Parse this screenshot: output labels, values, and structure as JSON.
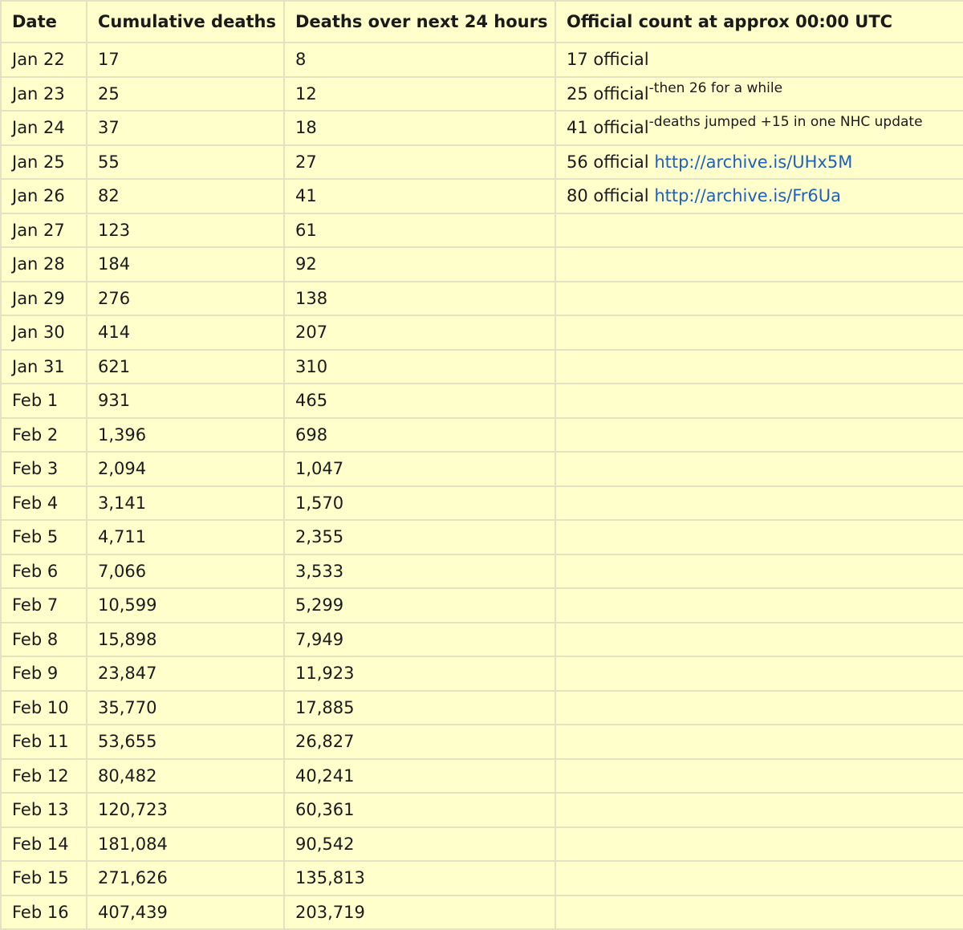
{
  "colors": {
    "background": "#ffffcc",
    "border": "#e3e3c4",
    "text": "#1a1a1a",
    "link": "#1f5fbf"
  },
  "headers": {
    "date": "Date",
    "cumulative": "Cumulative deaths",
    "next24": "Deaths over next 24 hours",
    "official": "Official count at approx 00:00 UTC"
  },
  "rows": [
    {
      "date": "Jan 22",
      "cumulative": "17",
      "next24": "8",
      "official": "17 official",
      "note": "",
      "link": ""
    },
    {
      "date": "Jan 23",
      "cumulative": "25",
      "next24": "12",
      "official": "25 official",
      "note": "-then 26 for a while",
      "link": ""
    },
    {
      "date": "Jan 24",
      "cumulative": "37",
      "next24": "18",
      "official": "41 official",
      "note": "-deaths jumped +15 in one NHC update",
      "link": ""
    },
    {
      "date": "Jan 25",
      "cumulative": "55",
      "next24": "27",
      "official": "56 official ",
      "note": "",
      "link": "http://archive.is/UHx5M"
    },
    {
      "date": "Jan 26",
      "cumulative": "82",
      "next24": "41",
      "official": "80 official ",
      "note": "",
      "link": "http://archive.is/Fr6Ua"
    },
    {
      "date": "Jan 27",
      "cumulative": "123",
      "next24": "61"
    },
    {
      "date": "Jan 28",
      "cumulative": "184",
      "next24": "92"
    },
    {
      "date": "Jan 29",
      "cumulative": "276",
      "next24": "138"
    },
    {
      "date": "Jan 30",
      "cumulative": "414",
      "next24": "207"
    },
    {
      "date": "Jan 31",
      "cumulative": "621",
      "next24": "310"
    },
    {
      "date": "Feb 1",
      "cumulative": "931",
      "next24": "465"
    },
    {
      "date": "Feb 2",
      "cumulative": "1,396",
      "next24": "698"
    },
    {
      "date": "Feb 3",
      "cumulative": "2,094",
      "next24": "1,047"
    },
    {
      "date": "Feb 4",
      "cumulative": "3,141",
      "next24": "1,570"
    },
    {
      "date": "Feb 5",
      "cumulative": "4,711",
      "next24": "2,355"
    },
    {
      "date": "Feb 6",
      "cumulative": "7,066",
      "next24": "3,533"
    },
    {
      "date": "Feb 7",
      "cumulative": "10,599",
      "next24": "5,299"
    },
    {
      "date": "Feb 8",
      "cumulative": "15,898",
      "next24": "7,949"
    },
    {
      "date": "Feb 9",
      "cumulative": "23,847",
      "next24": "11,923"
    },
    {
      "date": "Feb 10",
      "cumulative": "35,770",
      "next24": "17,885"
    },
    {
      "date": "Feb 11",
      "cumulative": "53,655",
      "next24": "26,827"
    },
    {
      "date": "Feb 12",
      "cumulative": "80,482",
      "next24": "40,241"
    },
    {
      "date": "Feb 13",
      "cumulative": "120,723",
      "next24": "60,361"
    },
    {
      "date": "Feb 14",
      "cumulative": "181,084",
      "next24": "90,542"
    },
    {
      "date": "Feb 15",
      "cumulative": "271,626",
      "next24": "135,813"
    },
    {
      "date": "Feb 16",
      "cumulative": "407,439",
      "next24": "203,719"
    }
  ]
}
